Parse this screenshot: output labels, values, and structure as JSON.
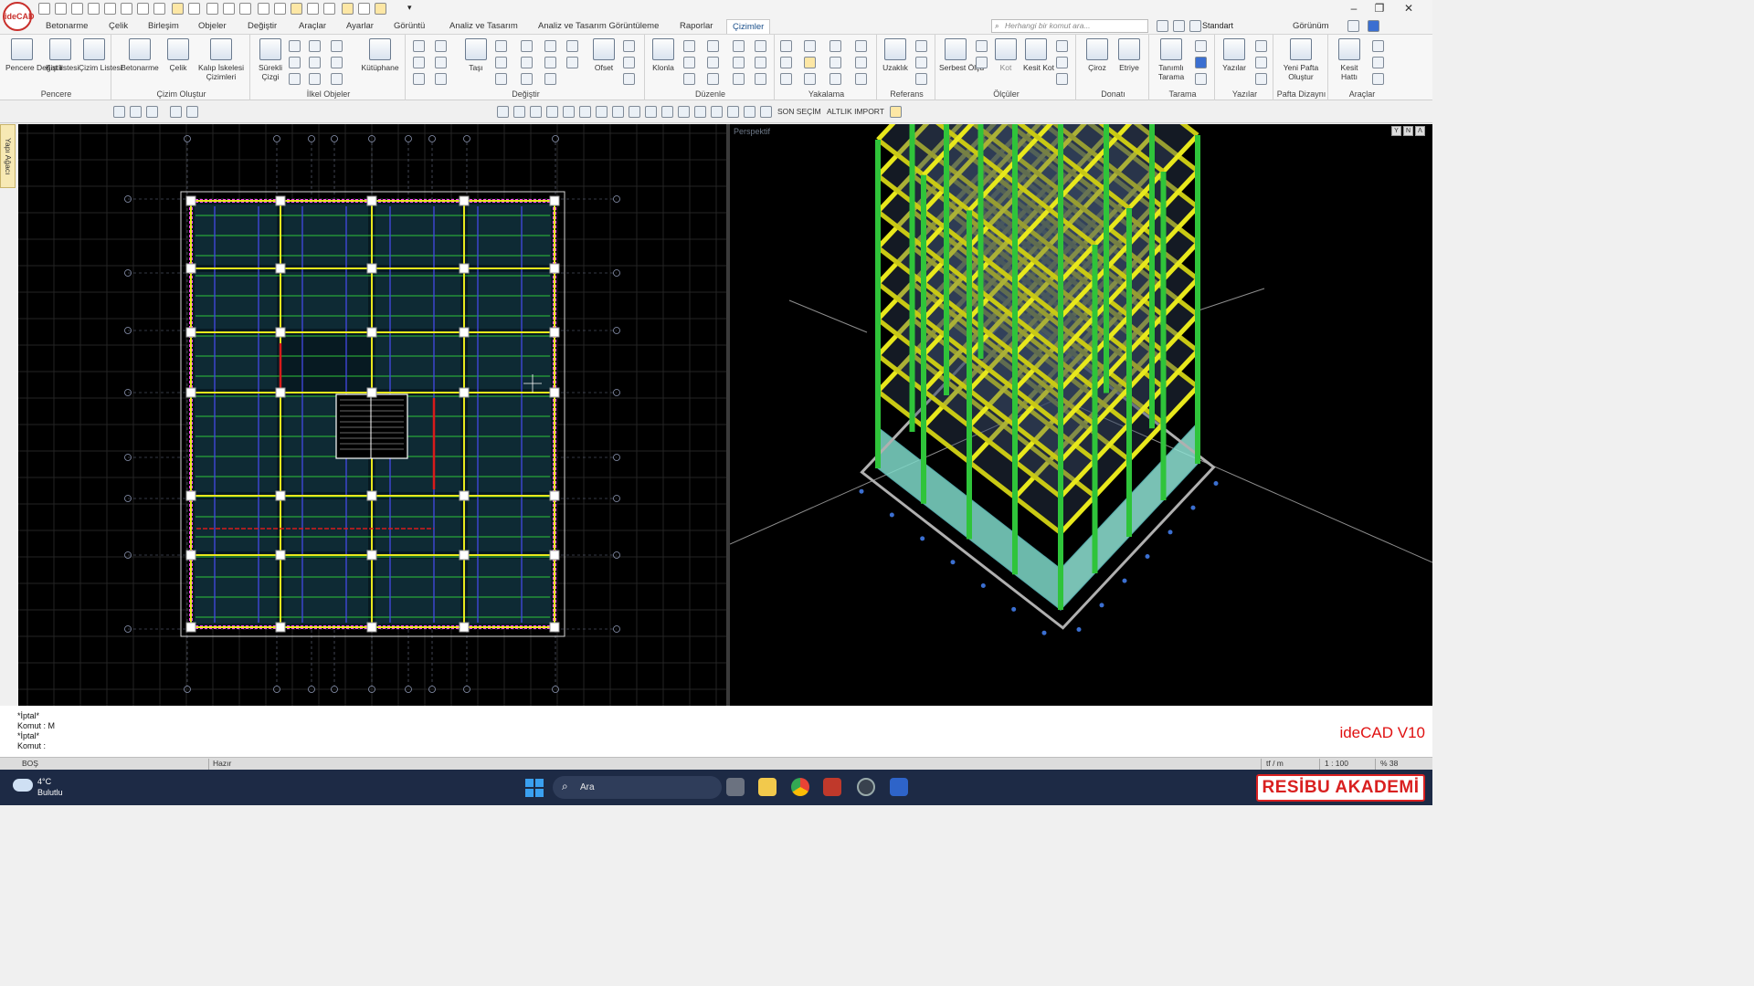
{
  "app": {
    "logo_text": "ideCAD"
  },
  "menu": {
    "tabs": [
      "Betonarme",
      "Çelik",
      "Birleşim",
      "Objeler",
      "Değiştir",
      "Araçlar",
      "Ayarlar",
      "Görüntü",
      "Analiz ve Tasarım",
      "Analiz ve Tasarım Görüntüleme",
      "Raporlar",
      "Çizimler"
    ],
    "active_tab": "Çizimler",
    "search_placeholder": "Herhangi bir komut ara...",
    "style_select": "Standart",
    "view_menu": "Görünüm"
  },
  "ribbon": {
    "groups": [
      {
        "label": "Pencere",
        "buttons": [
          "Pencere Değiştir",
          "Kat listesi",
          "Çizim Listesi"
        ]
      },
      {
        "label": "Çizim Oluştur",
        "buttons": [
          "Betonarme",
          "Çelik",
          "Kalıp İskelesi Çizimleri"
        ]
      },
      {
        "label": "İlkel Objeler",
        "buttons": [
          "Sürekli Çizgi",
          "Kütüphane"
        ]
      },
      {
        "label": "Değiştir",
        "buttons": [
          "Taşı",
          "Ofset"
        ]
      },
      {
        "label": "Düzenle",
        "buttons": [
          "Klonla"
        ]
      },
      {
        "label": "Yakalama",
        "buttons": []
      },
      {
        "label": "Referans",
        "buttons": [
          "Uzaklık"
        ]
      },
      {
        "label": "Ölçüler",
        "buttons": [
          "Serbest Ölçü",
          "Kot",
          "Kesit Kot"
        ]
      },
      {
        "label": "Donatı",
        "buttons": [
          "Çiroz",
          "Etriye"
        ]
      },
      {
        "label": "Tarama",
        "buttons": [
          "Tanımlı Tarama"
        ]
      },
      {
        "label": "Yazılar",
        "buttons": [
          "Yazılar"
        ]
      },
      {
        "label": "Pafta Dizaynı",
        "buttons": [
          "Yeni Pafta Oluştur"
        ]
      },
      {
        "label": "Araçlar",
        "buttons": [
          "Kesit Hattı"
        ]
      }
    ]
  },
  "toolbar2": {
    "son_secim": "SON SEÇİM",
    "altlik_import": "ALTLIK IMPORT"
  },
  "side_tab": "Yapı Ağacı",
  "perspective": {
    "label": "Perspektif"
  },
  "command": {
    "lines": [
      "*İptal*",
      "Komut : M",
      "*İptal*",
      "Komut :"
    ],
    "version": "ideCAD V10"
  },
  "status": {
    "mode": "BOŞ",
    "state": "Hazır",
    "unit": "tf / m",
    "scale": "1 : 100",
    "zoom": "% 38"
  },
  "taskbar": {
    "temperature": "4°C",
    "weather": "Bulutlu",
    "search": "Ara",
    "brand": "RESİBU AKADEMİ"
  },
  "colors": {
    "beam_yellow": "#e8e81c",
    "column_green": "#2fc43a",
    "slab_magenta": "#ff44ff",
    "brand_red": "#d92020"
  },
  "icons": [
    "windows-start-icon",
    "search-icon",
    "file-explorer-icon",
    "chrome-icon",
    "ideCAD-taskbar-icon"
  ]
}
